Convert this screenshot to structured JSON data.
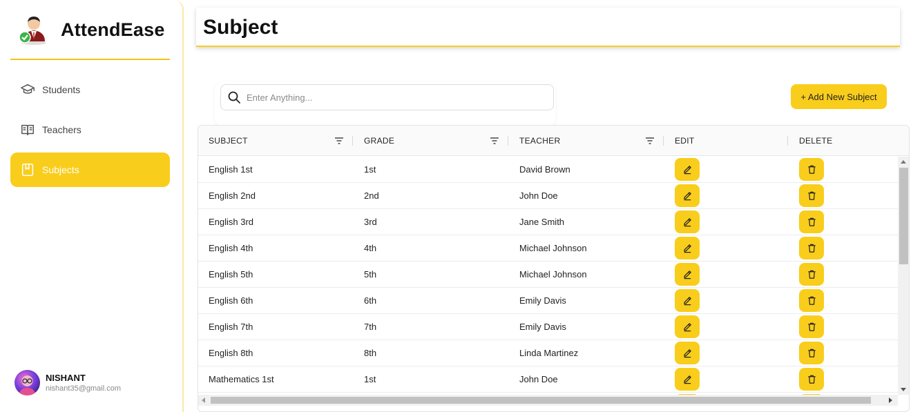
{
  "app": {
    "name": "AttendEase"
  },
  "sidebar": {
    "items": [
      {
        "label": "Students",
        "icon": "graduation-cap-icon",
        "active": false
      },
      {
        "label": "Teachers",
        "icon": "open-book-icon",
        "active": false
      },
      {
        "label": "Subjects",
        "icon": "bookmark-book-icon",
        "active": true
      }
    ]
  },
  "user": {
    "name": "NISHANT",
    "email": "nishant35@gmail.com"
  },
  "header": {
    "title": "Subject"
  },
  "search": {
    "placeholder": "Enter Anything...",
    "value": ""
  },
  "toolbar": {
    "add_label": "+ Add New Subject"
  },
  "table": {
    "columns": [
      "SUBJECT",
      "GRADE",
      "TEACHER",
      "EDIT",
      "DELETE"
    ],
    "rows": [
      {
        "subject": "English 1st",
        "grade": "1st",
        "teacher": "David Brown"
      },
      {
        "subject": "English 2nd",
        "grade": "2nd",
        "teacher": "John Doe"
      },
      {
        "subject": "English 3rd",
        "grade": "3rd",
        "teacher": "Jane Smith"
      },
      {
        "subject": "English 4th",
        "grade": "4th",
        "teacher": "Michael Johnson"
      },
      {
        "subject": "English 5th",
        "grade": "5th",
        "teacher": "Michael Johnson"
      },
      {
        "subject": "English 6th",
        "grade": "6th",
        "teacher": "Emily Davis"
      },
      {
        "subject": "English 7th",
        "grade": "7th",
        "teacher": "Emily Davis"
      },
      {
        "subject": "English 8th",
        "grade": "8th",
        "teacher": "Linda Martinez"
      },
      {
        "subject": "Mathematics 1st",
        "grade": "1st",
        "teacher": "John Doe"
      }
    ]
  },
  "colors": {
    "accent": "#f9cd1b",
    "active_text": "#ffffff"
  }
}
